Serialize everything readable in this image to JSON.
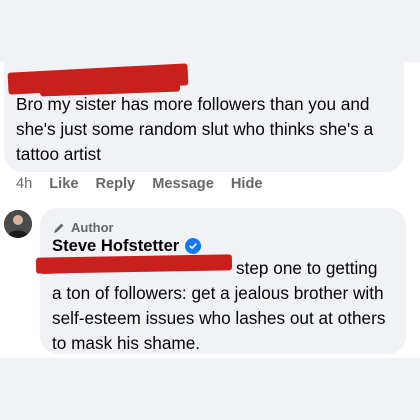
{
  "original_comment": {
    "text": "Bro my sister has more followers than you and she's just some random slut who thinks she's a tattoo artist",
    "actions": {
      "time": "4h",
      "like": "Like",
      "reply": "Reply",
      "message": "Message",
      "hide": "Hide"
    }
  },
  "reply": {
    "badge": "Author",
    "author_name": "Steve Hofstetter",
    "text_line_1": "step one to getting",
    "text_rest": "a ton of followers: get a jealous brother with self-esteem issues who lashes out at others to mask his shame."
  },
  "colors": {
    "bubble": "#f0f2f5",
    "meta_text": "#65676b",
    "verified": "#1877f2",
    "redaction": "#c9201e"
  }
}
